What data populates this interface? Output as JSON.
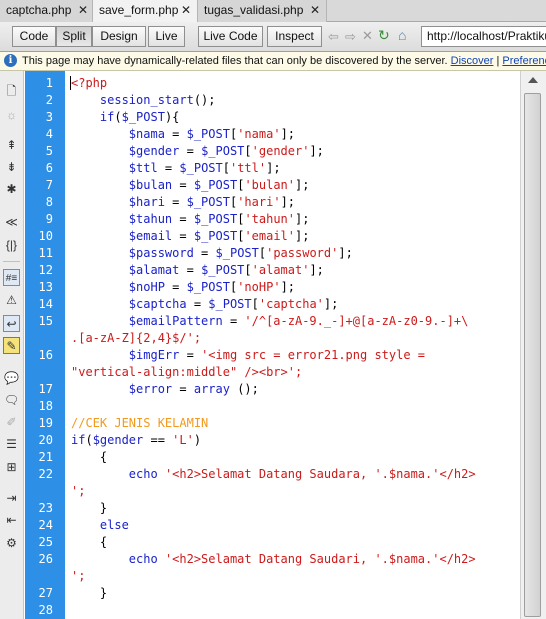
{
  "tabs": [
    {
      "label": "captcha.php",
      "active": false
    },
    {
      "label": "save_form.php",
      "active": true
    },
    {
      "label": "tugas_validasi.php",
      "active": false
    }
  ],
  "toolbar": {
    "code_label": "Code",
    "split_label": "Split",
    "design_label": "Design",
    "live_label": "Live",
    "live_code_label": "Live Code",
    "inspect_label": "Inspect",
    "url_value": "http://localhost/Praktikum"
  },
  "infobar": {
    "message": "This page may have dynamically-related files that can only be discovered by the server.",
    "discover_link": "Discover",
    "separator": "|",
    "preferences_link": "Preferences"
  },
  "editor": {
    "line_numbers": [
      "1",
      "2",
      "3",
      "4",
      "5",
      "6",
      "7",
      "8",
      "9",
      "10",
      "11",
      "12",
      "13",
      "14",
      "15",
      "",
      "16",
      "",
      "17",
      "18",
      "19",
      "20",
      "21",
      "22",
      "",
      "23",
      "24",
      "25",
      "26",
      "",
      "27",
      "28"
    ],
    "code_lines": [
      "<?php",
      "    session_start();",
      "    if($_POST){",
      "        $nama = $_POST['nama'];",
      "        $gender = $_POST['gender'];",
      "        $ttl = $_POST['ttl'];",
      "        $bulan = $_POST['bulan'];",
      "        $hari = $_POST['hari'];",
      "        $tahun = $_POST['tahun'];",
      "        $email = $_POST['email'];",
      "        $password = $_POST['password'];",
      "        $alamat = $_POST['alamat'];",
      "        $noHP = $_POST['noHP'];",
      "        $captcha = $_POST['captcha'];",
      "        $emailPattern = '/^[a-zA-9._-]+@[a-zA-z0-9.-]+\\",
      ".[a-zA-Z]{2,4}$/';",
      "        $imgErr = '<img src = error21.png style =",
      "\"vertical-align:middle\" /><br>';",
      "        $error = array ();",
      "",
      "//CEK JENIS KELAMIN",
      "if($gender == 'L')",
      "    {",
      "        echo '<h2>Selamat Datang Saudara, '.$nama.'</h2>",
      "';",
      "    }",
      "    else",
      "    {",
      "        echo '<h2>Selamat Datang Saudari, '.$nama.'</h2>",
      "';",
      "    }",
      ""
    ]
  },
  "colors": {
    "gutter": "#2e8fe6",
    "keyword": "#1a22c9",
    "string": "#cc1a1a",
    "comment": "#f29a1f",
    "infobar": "#fdfbe7"
  },
  "icons": [
    "file-icon",
    "sun-icon",
    "collapse-full-tag-icon",
    "collapse-selection-icon",
    "expand-all-icon",
    "select-parent-tag-icon",
    "balance-braces-icon",
    "line-numbers-icon",
    "highlight-invalid-icon",
    "word-wrap-icon",
    "syntax-coloring-icon",
    "comment-icon",
    "remove-comment-icon",
    "wrap-tag-icon",
    "recent-snippets-icon",
    "move-css-icon",
    "indent-icon",
    "outdent-icon",
    "format-source-icon"
  ]
}
